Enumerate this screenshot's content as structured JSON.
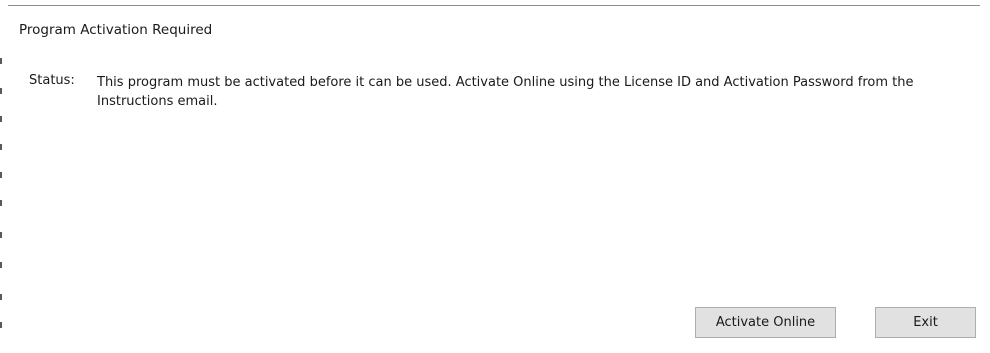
{
  "dialog": {
    "title": "Program Activation Required",
    "status_label": "Status:",
    "status_message": "This program must be activated before it can be used. Activate Online using the License ID and Activation Password from the Instructions email."
  },
  "buttons": {
    "activate_online": "Activate Online",
    "exit": "Exit"
  },
  "colors": {
    "background": "#ffffff",
    "button_face": "#e1e1e1",
    "button_border": "#adadad"
  }
}
